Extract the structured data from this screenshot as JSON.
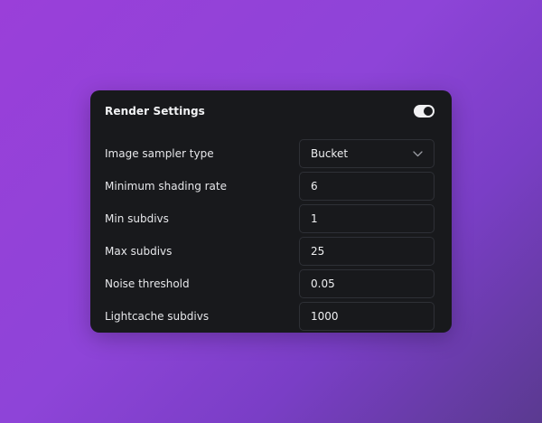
{
  "panel": {
    "title": "Render Settings",
    "toggle_on": true
  },
  "settings": {
    "sampler": {
      "label": "Image sampler type",
      "value": "Bucket"
    },
    "min_shading_rate": {
      "label": "Minimum shading rate",
      "value": "6"
    },
    "min_subdivs": {
      "label": "Min subdivs",
      "value": "1"
    },
    "max_subdivs": {
      "label": "Max subdivs",
      "value": "25"
    },
    "noise_threshold": {
      "label": "Noise threshold",
      "value": "0.05"
    },
    "lightcache_subdivs": {
      "label": "Lightcache subdivs",
      "value": "1000"
    }
  },
  "colors": {
    "panel_bg": "#18191c",
    "field_border": "#2e3036",
    "text": "#eeeff1"
  },
  "icons": {
    "toggle": "toggle-switch-icon",
    "dropdown": "chevron-down-icon"
  }
}
